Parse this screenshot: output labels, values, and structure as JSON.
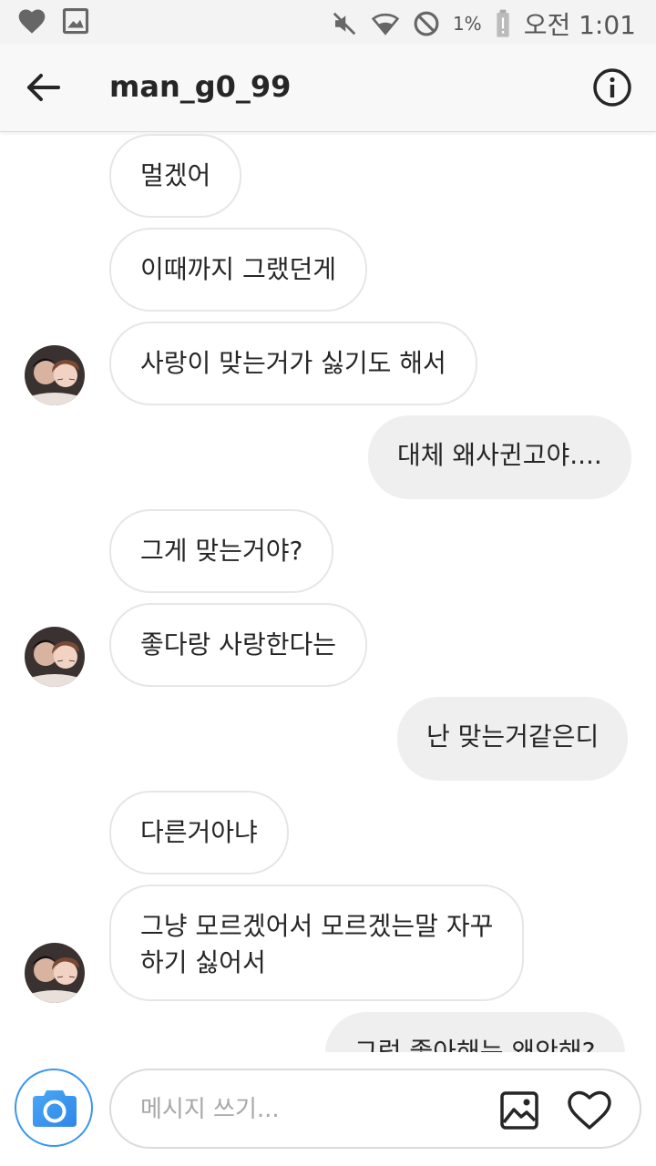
{
  "status_bar": {
    "battery_percent": "1%",
    "time": "오전 1:01"
  },
  "header": {
    "username": "man_g0_99"
  },
  "messages": [
    {
      "side": "in",
      "text": "멀겠어"
    },
    {
      "side": "in",
      "text": "이때까지 그랬던게"
    },
    {
      "side": "in",
      "text": "사랑이 맞는거가 싫기도 해서"
    },
    {
      "side": "out",
      "text": "대체 왜사귄고야...."
    },
    {
      "side": "in",
      "text": "그게 맞는거야?"
    },
    {
      "side": "in",
      "text": "좋다랑 사랑한다는"
    },
    {
      "side": "out",
      "text": "난 맞는거같은디"
    },
    {
      "side": "in",
      "text": "다른거아냐"
    },
    {
      "side": "in",
      "text": "그냥 모르겠어서 모르겠는말 자꾸\n하기 싫어서"
    },
    {
      "side": "out",
      "text": "그럼 좋아해는 왜안해?"
    }
  ],
  "composer": {
    "placeholder": "메시지 쓰기..."
  },
  "colors": {
    "accent": "#3897f0",
    "incoming_border": "#e6e6e6",
    "outgoing_fill": "#efefef"
  },
  "icons": {
    "status_left": [
      "heart-icon",
      "image-icon"
    ],
    "status_right": [
      "mute-icon",
      "wifi-icon",
      "no-disturb-icon",
      "battery-icon"
    ],
    "header": [
      "back-arrow-icon",
      "info-icon"
    ],
    "composer": [
      "camera-icon",
      "gallery-icon",
      "heart-icon"
    ]
  }
}
